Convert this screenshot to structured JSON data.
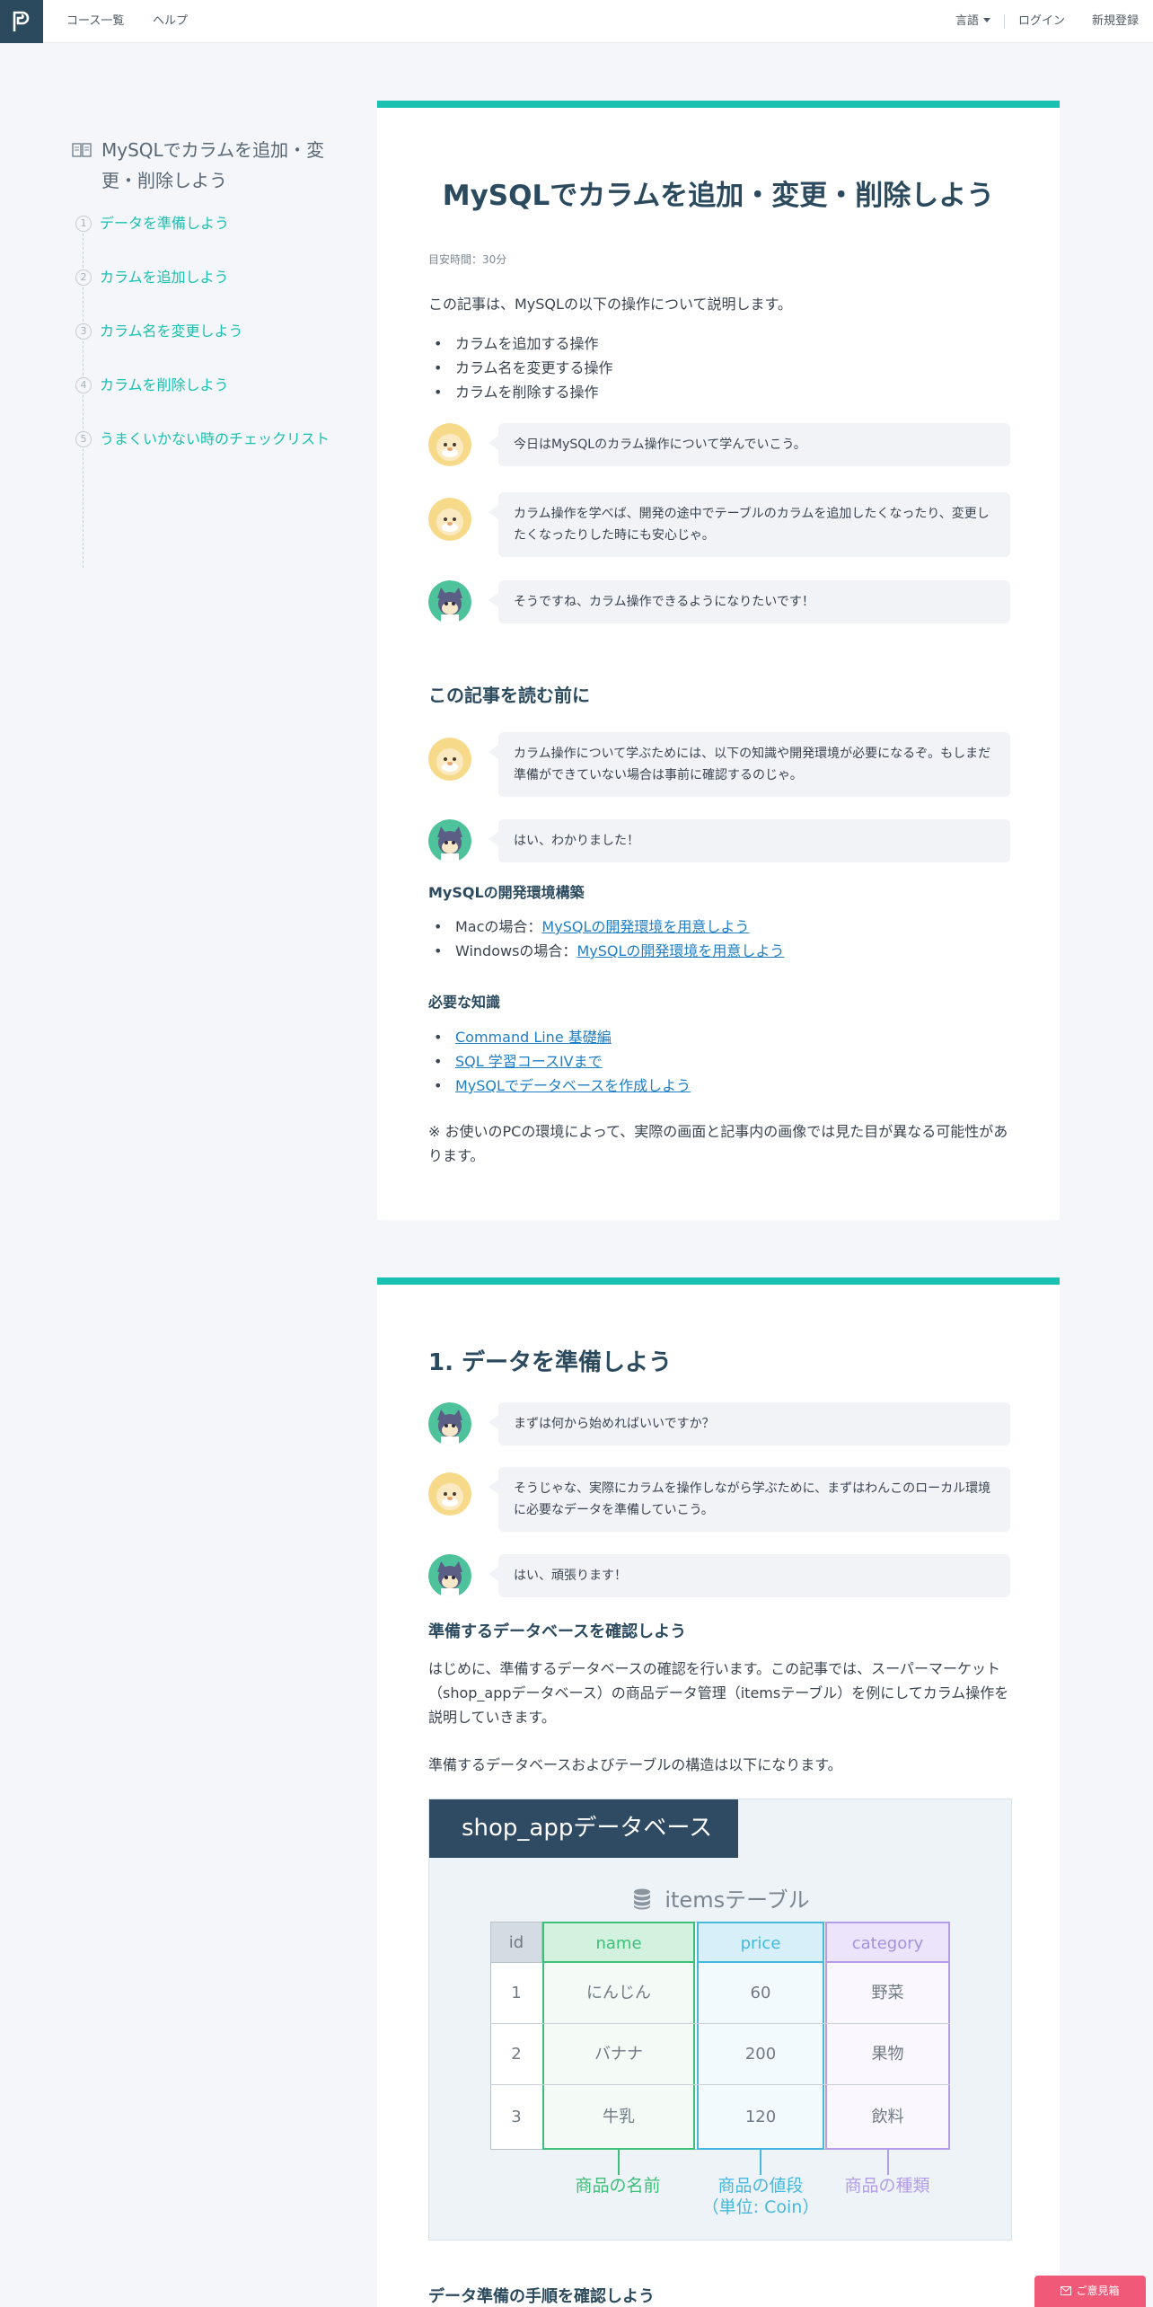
{
  "header": {
    "nav_courses": "コース一覧",
    "nav_help": "ヘルプ",
    "nav_language": "言語",
    "nav_login": "ログイン",
    "nav_signup": "新規登録"
  },
  "toc": {
    "title": "MySQLでカラムを追加・変更・削除しよう",
    "items": [
      {
        "num": "1",
        "label": "データを準備しよう"
      },
      {
        "num": "2",
        "label": "カラムを追加しよう"
      },
      {
        "num": "3",
        "label": "カラム名を変更しよう"
      },
      {
        "num": "4",
        "label": "カラムを削除しよう"
      },
      {
        "num": "5",
        "label": "うまくいかない時のチェックリスト"
      }
    ]
  },
  "article": {
    "title": "MySQLでカラムを追加・変更・削除しよう",
    "estimated_time": "目安時間：30分",
    "intro": "この記事は、MySQLの以下の操作について説明します。",
    "intro_bullets": [
      "カラムを追加する操作",
      "カラム名を変更する操作",
      "カラムを削除する操作"
    ],
    "chat1": [
      {
        "speaker": "sensei",
        "text": "今日はMySQLのカラム操作について学んでいこう。"
      },
      {
        "speaker": "sensei",
        "text": "カラム操作を学べば、開発の途中でテーブルのカラムを追加したくなったり、変更したくなったりした時にも安心じゃ。"
      },
      {
        "speaker": "student",
        "text": "そうですね、カラム操作できるようになりたいです！"
      }
    ],
    "before_heading": "この記事を読む前に",
    "chat2": [
      {
        "speaker": "sensei",
        "text": "カラム操作について学ぶためには、以下の知識や開発環境が必要になるぞ。もしまだ準備ができていない場合は事前に確認するのじゃ。"
      },
      {
        "speaker": "student",
        "text": "はい、わかりました！"
      }
    ],
    "env_heading": "MySQLの開発環境構築",
    "env_items": [
      {
        "prefix": "Macの場合：",
        "link": "MySQLの開発環境を用意しよう"
      },
      {
        "prefix": "Windowsの場合：",
        "link": "MySQLの開発環境を用意しよう"
      }
    ],
    "knowledge_heading": "必要な知識",
    "knowledge_links": [
      "Command Line 基礎編",
      "SQL 学習コースIVまで",
      "MySQLでデータベースを作成しよう"
    ],
    "note": "※ お使いのPCの環境によって、実際の画面と記事内の画像では見た目が異なる可能性があります。"
  },
  "section1": {
    "heading": "1. データを準備しよう",
    "chat": [
      {
        "speaker": "student",
        "text": "まずは何から始めればいいですか？"
      },
      {
        "speaker": "sensei",
        "text": "そうじゃな、実際にカラムを操作しながら学ぶために、まずはわんこのローカル環境に必要なデータを準備していこう。"
      },
      {
        "speaker": "student",
        "text": "はい、頑張ります！"
      }
    ],
    "sub_heading": "準備するデータベースを確認しよう",
    "para1": "はじめに、準備するデータベースの確認を行います。この記事では、スーパーマーケット（shop_appデータベース）の商品データ管理（itemsテーブル）を例にしてカラム操作を説明していきます。",
    "para2": "準備するデータベースおよびテーブルの構造は以下になります。",
    "next_heading": "データ準備の手順を確認しよう"
  },
  "diagram": {
    "db_label": "shop_appデータベース",
    "table_label": "itemsテーブル",
    "columns": [
      "id",
      "name",
      "price",
      "category"
    ],
    "rows": [
      [
        "1",
        "にんじん",
        "60",
        "野菜"
      ],
      [
        "2",
        "バナナ",
        "200",
        "果物"
      ],
      [
        "3",
        "牛乳",
        "120",
        "飲料"
      ]
    ],
    "label_name": "商品の名前",
    "label_price_1": "商品の値段",
    "label_price_2": "（単位: Coin）",
    "label_category": "商品の種類",
    "colors": {
      "name": "#3dbf7a",
      "price": "#45b8dc",
      "category": "#b39de6"
    }
  },
  "feedback_button": "ご意見箱"
}
